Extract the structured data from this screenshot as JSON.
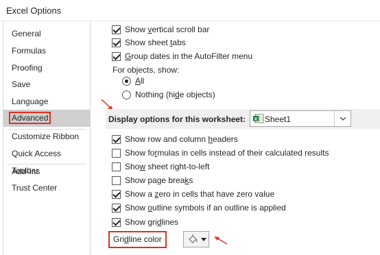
{
  "window": {
    "title": "Excel Options"
  },
  "sidebar": {
    "items": [
      {
        "label": "General"
      },
      {
        "label": "Formulas"
      },
      {
        "label": "Proofing"
      },
      {
        "label": "Save"
      },
      {
        "label": "Language"
      },
      {
        "label": "Advanced",
        "selected": true
      },
      {
        "label": "Customize Ribbon"
      },
      {
        "label": "Quick Access Toolbar"
      },
      {
        "label": "Add-Ins"
      },
      {
        "label": "Trust Center"
      }
    ]
  },
  "workbook_options": {
    "show_vertical_scroll": {
      "label_pre": "Show ",
      "label_u": "v",
      "label_post": "ertical scroll bar",
      "checked": true
    },
    "show_sheet_tabs": {
      "label_pre": "Show sheet ",
      "label_u": "t",
      "label_post": "abs",
      "checked": true
    },
    "group_dates": {
      "label_pre": "",
      "label_u": "G",
      "label_post": "roup dates in the AutoFilter menu",
      "checked": true
    },
    "for_objects_label": "For objects, show:",
    "radio_all": {
      "label_u": "A",
      "label_post": "ll",
      "selected": true
    },
    "radio_nothing": {
      "label_pre": "Nothing (hi",
      "label_u": "d",
      "label_post": "e objects)",
      "selected": false
    }
  },
  "worksheet_section": {
    "label": "Display options for this worksheet:",
    "sheet_value": "Sheet1"
  },
  "worksheet_options": [
    {
      "pre": "Show row and column ",
      "u": "h",
      "post": "eaders",
      "checked": true
    },
    {
      "pre": "Show fo",
      "u": "r",
      "post": "mulas in cells instead of their calculated results",
      "checked": false
    },
    {
      "pre": "Sho",
      "u": "w",
      "post": " sheet right-to-left",
      "checked": false
    },
    {
      "pre": "Show page brea",
      "u": "k",
      "post": "s",
      "checked": false
    },
    {
      "pre": "Show a ",
      "u": "z",
      "post": "ero in cells that have zero value",
      "checked": true
    },
    {
      "pre": "Show ",
      "u": "o",
      "post": "utline symbols if an outline is applied",
      "checked": true
    },
    {
      "pre": "Show gri",
      "u": "d",
      "post": "lines",
      "checked": true
    }
  ],
  "gridline_color": {
    "pre": "Gri",
    "u": "d",
    "post": "line color"
  },
  "colors": {
    "highlight": "#e0301e",
    "selected_bg": "#cfcfcf"
  }
}
